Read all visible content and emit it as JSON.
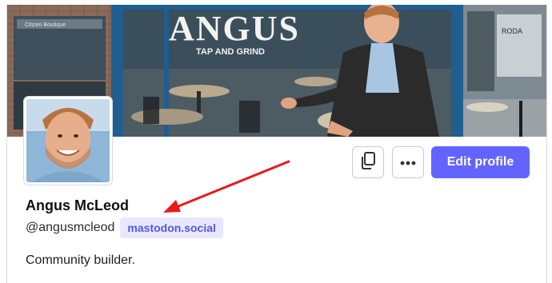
{
  "header": {
    "storefront_title": "ANGUS",
    "storefront_subtitle": "TAP AND GRIND",
    "shop_sign_left": "Citizen Boutique",
    "shop_sign_right": "RODA"
  },
  "profile": {
    "display_name": "Angus McLeod",
    "handle": "@angusmcleod",
    "domain": "mastodon.social",
    "bio": "Community builder."
  },
  "actions": {
    "edit_label": "Edit profile",
    "copy_icon": "copy-icon",
    "more_icon": "more-icon"
  },
  "colors": {
    "accent": "#6364ff",
    "domain_badge_bg": "#e7e8ff",
    "annotation_arrow": "#e8191d"
  }
}
